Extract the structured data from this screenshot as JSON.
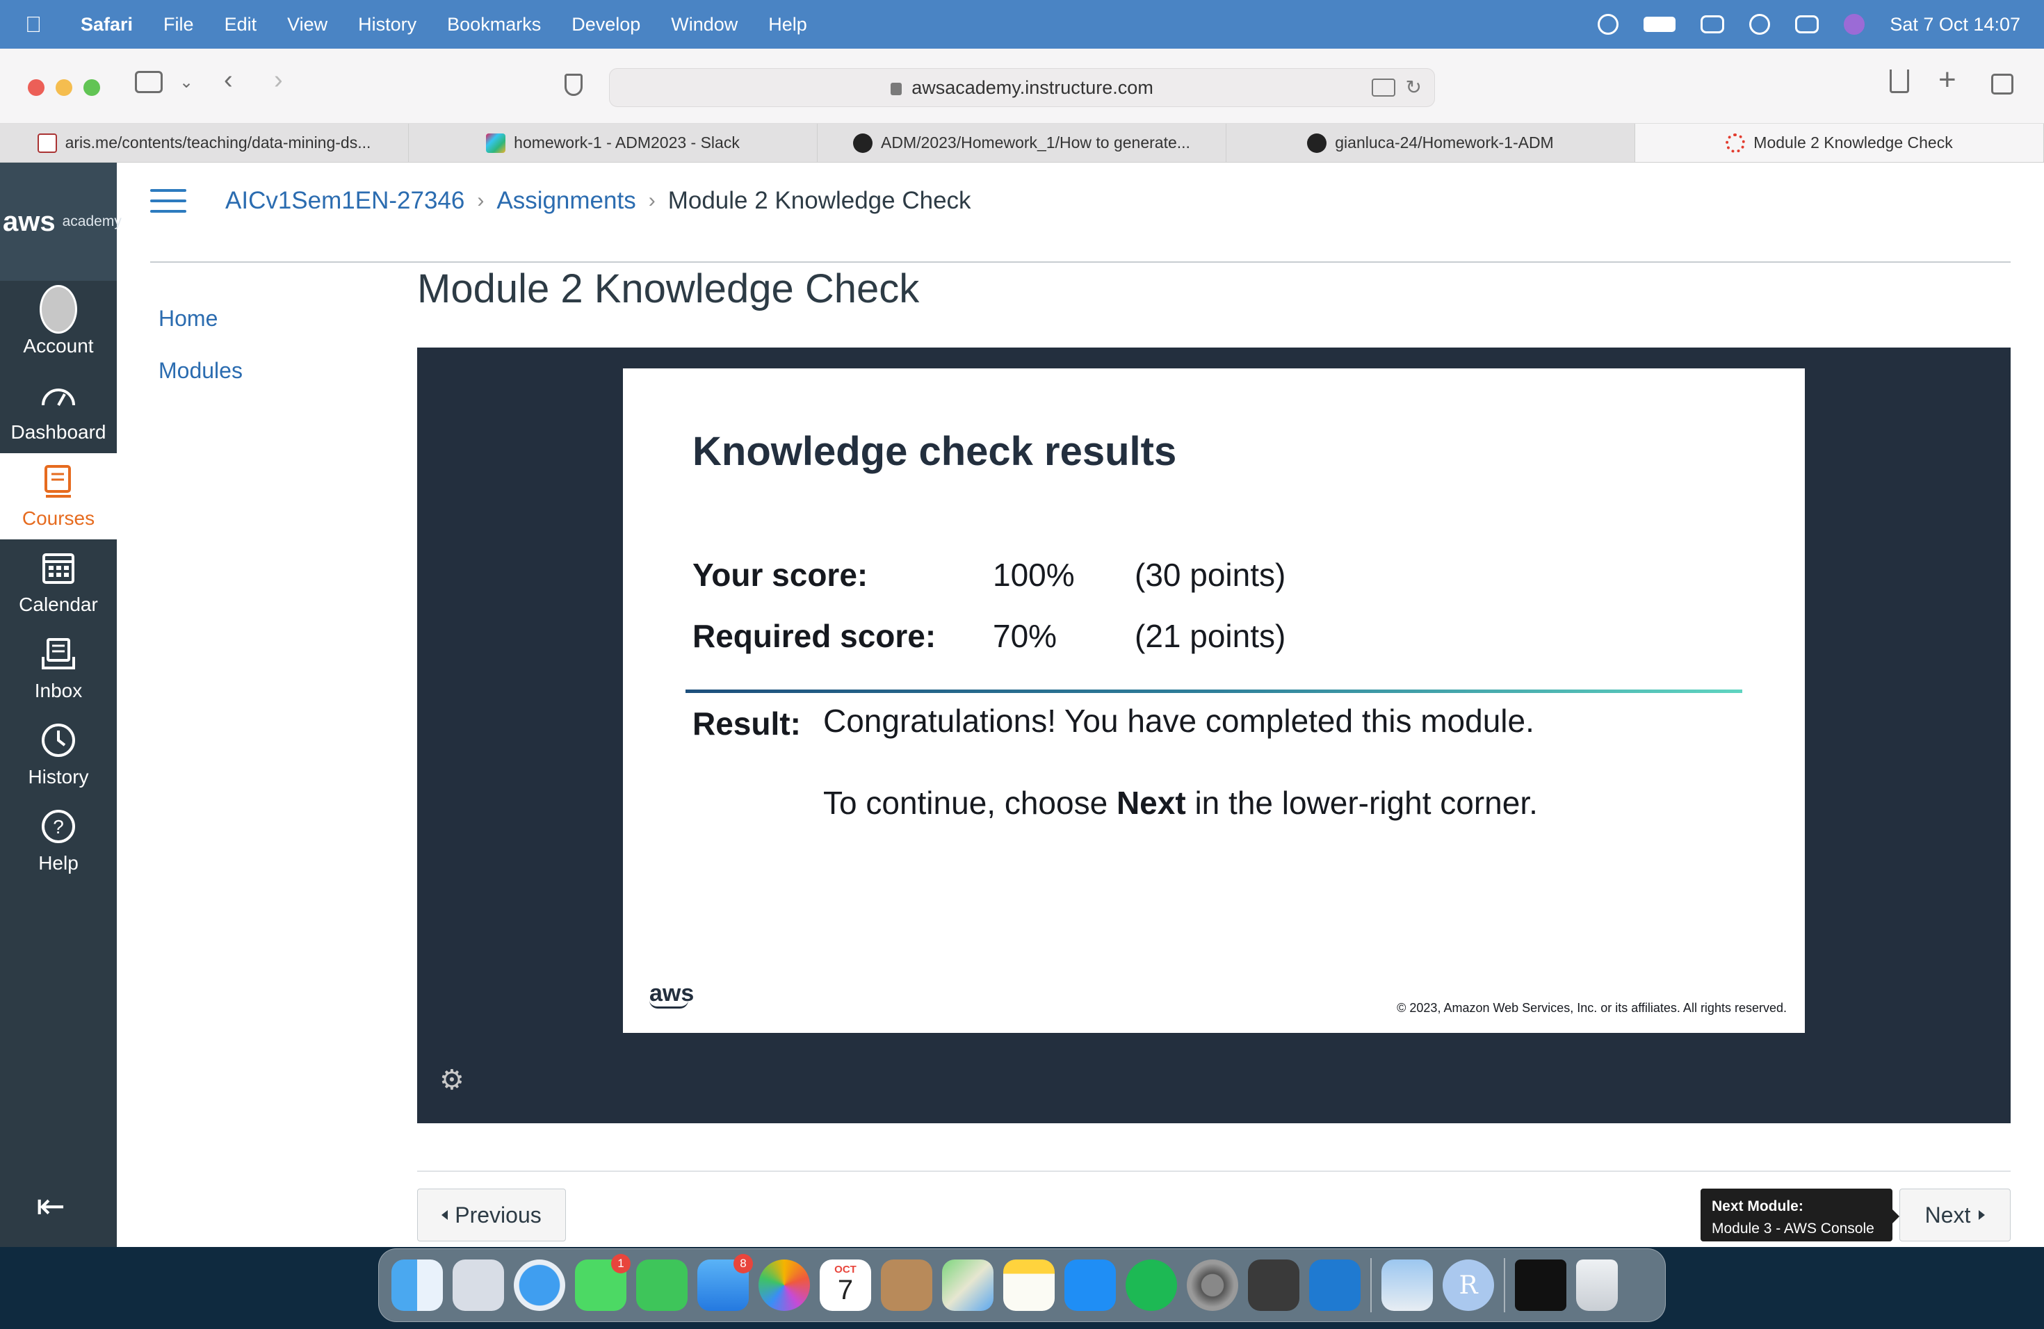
{
  "menubar": {
    "app": "Safari",
    "items": [
      "File",
      "Edit",
      "View",
      "History",
      "Bookmarks",
      "Develop",
      "Window",
      "Help"
    ],
    "clock": "Sat 7 Oct  14:07"
  },
  "browser": {
    "url": "awsacademy.instructure.com",
    "tabs": [
      {
        "title": "aris.me/contents/teaching/data-mining-ds...",
        "icon": "aris-favicon",
        "active": false
      },
      {
        "title": "homework-1 - ADM2023 - Slack",
        "icon": "slack-icon",
        "active": false
      },
      {
        "title": "ADM/2023/Homework_1/How to generate...",
        "icon": "github-icon",
        "active": false
      },
      {
        "title": "gianluca-24/Homework-1-ADM",
        "icon": "github-icon",
        "active": false
      },
      {
        "title": "Module 2 Knowledge Check",
        "icon": "canvas-icon",
        "active": true
      }
    ]
  },
  "global_nav": {
    "logo_main": "aws",
    "logo_sub": "academy",
    "items": [
      {
        "label": "Account",
        "icon": "account-avatar-icon"
      },
      {
        "label": "Dashboard",
        "icon": "dashboard-gauge-icon"
      },
      {
        "label": "Courses",
        "icon": "courses-book-icon",
        "active": true
      },
      {
        "label": "Calendar",
        "icon": "calendar-icon"
      },
      {
        "label": "Inbox",
        "icon": "inbox-icon"
      },
      {
        "label": "History",
        "icon": "history-clock-icon"
      },
      {
        "label": "Help",
        "icon": "help-question-icon"
      }
    ]
  },
  "breadcrumb": {
    "course": "AICv1Sem1EN-27346",
    "section": "Assignments",
    "current": "Module 2 Knowledge Check"
  },
  "course_nav": [
    "Home",
    "Modules"
  ],
  "page_title": "Module 2 Knowledge Check",
  "slide": {
    "title": "Knowledge check results",
    "your_score_label": "Your score:",
    "your_score_pct": "100%",
    "your_score_points": "(30 points)",
    "required_label": "Required score:",
    "required_pct": "70%",
    "required_points": "(21 points)",
    "result_label": "Result:",
    "result_message": "Congratulations! You have completed this module.",
    "continue_prefix": "To continue, choose ",
    "continue_bold": "Next",
    "continue_suffix": " in the lower-right corner.",
    "logo": "aws",
    "copyright": "© 2023, Amazon Web Services, Inc. or its affiliates. All rights reserved."
  },
  "footer": {
    "previous": "Previous",
    "next": "Next",
    "tooltip_title": "Next Module:",
    "tooltip_text": "Module 3 - AWS Console"
  },
  "dock": {
    "calendar_month": "OCT",
    "calendar_day": "7",
    "messages_badge": "1",
    "mail_badge": "8",
    "r_label": "R"
  }
}
